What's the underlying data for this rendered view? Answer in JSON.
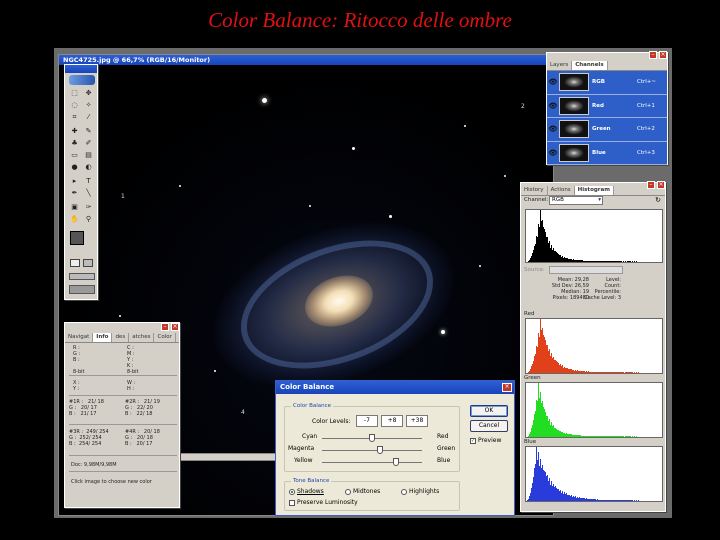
{
  "slide": {
    "title": "Color Balance: Ritocco delle ombre"
  },
  "document": {
    "title": "NGC4725.jpg @ 66,7% (RGB/16/Monitor)"
  },
  "channels": {
    "tabs": [
      "Layers",
      "Channels"
    ],
    "rows": [
      {
        "name": "RGB",
        "shortcut": "Ctrl+~"
      },
      {
        "name": "Red",
        "shortcut": "Ctrl+1"
      },
      {
        "name": "Green",
        "shortcut": "Ctrl+2"
      },
      {
        "name": "Blue",
        "shortcut": "Ctrl+3"
      }
    ]
  },
  "histogram": {
    "tabs": [
      "History",
      "Actions",
      "Histogram"
    ],
    "channel_label": "Channel:",
    "channel_value": "RGB",
    "source_label": "Source:",
    "stats_left": "Mean: 29,28\nStd Dev: 26,59\nMedian: 19\nPixels: 189480",
    "stats_right": "Level:\nCount:\nPercentile:\nCache Level: 3",
    "red_label": "Red",
    "green_label": "Green",
    "blue_label": "Blue",
    "colors": {
      "red": "#e0401a",
      "green": "#22dd22",
      "blue": "#2a3bdc"
    }
  },
  "info": {
    "tabs": [
      "Navigat",
      "Info",
      "des",
      "atches",
      "Color"
    ],
    "block1_left": "R :\nG :\nB :\n\n8-bit",
    "block1_right": "C :\nM :\nY :\nK :\n8-bit",
    "block2_left": "X :\nY :",
    "block2_right": "W :\nH :",
    "block3_left": "#1R :   21/ 18\nG :   20/ 17\nB :   21/ 17",
    "block3_right": "#2R :   21/ 19\nG :   22/ 20\nB :   22/ 18",
    "block4_left": "#3R :  249/ 254\nG :  252/ 254\nB :  254/ 254",
    "block4_right": "#4R :   20/ 18\nG :   20/ 18\nB :   20/ 17",
    "doc": "Doc: 9,98M/9,98M",
    "hint": "Click image to choose new color"
  },
  "color_balance": {
    "title": "Color Balance",
    "group1": "Color Balance",
    "levels_label": "Color Levels:",
    "levels": [
      "-7",
      "+8",
      "+38"
    ],
    "sliders": [
      {
        "left": "Cyan",
        "right": "Red"
      },
      {
        "left": "Magenta",
        "right": "Green"
      },
      {
        "left": "Yellow",
        "right": "Blue"
      }
    ],
    "group2": "Tone Balance",
    "tones": [
      "Shadows",
      "Midtones",
      "Highlights"
    ],
    "preserve": "Preserve Luminosity",
    "ok": "OK",
    "cancel": "Cancel",
    "preview": "Preview"
  },
  "markers": [
    "1",
    "2",
    "3",
    "4"
  ],
  "tools": [
    "T",
    "P"
  ]
}
